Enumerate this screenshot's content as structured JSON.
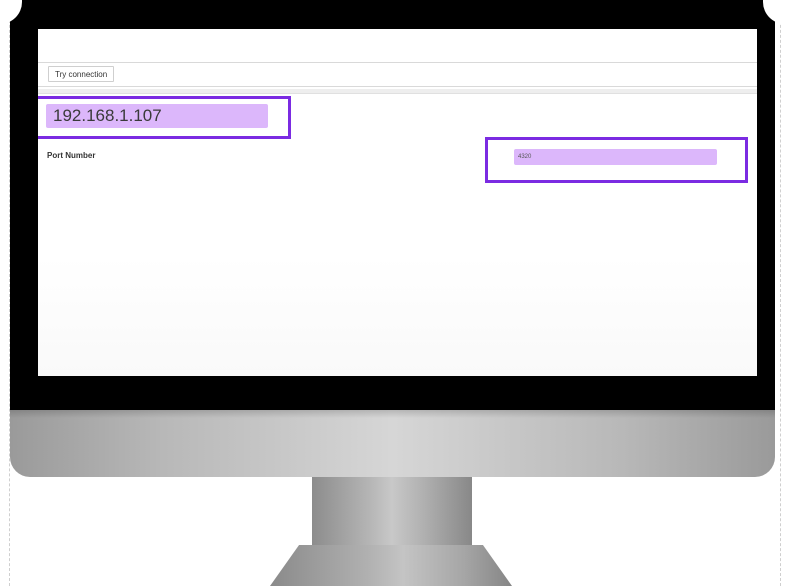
{
  "toolbar": {
    "try_connection_label": "Try connection"
  },
  "form": {
    "ip_address_value": "192.168.1.107",
    "port_label": "Port Number",
    "port_value": "4320"
  },
  "colors": {
    "highlight_fill": "#dcb7fb",
    "highlight_border": "#7b2be2",
    "bezel": "#000000"
  }
}
